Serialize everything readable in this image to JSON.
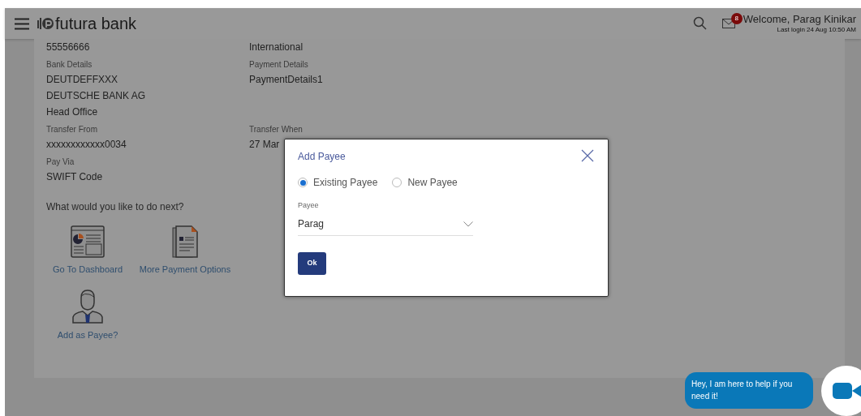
{
  "header": {
    "brand": "futura bank",
    "notifications": "8",
    "welcome": "Welcome, Parag Kinikar",
    "last_login": "Last login 24 Aug 10:50 AM"
  },
  "details": [
    {
      "left": {
        "values": [
          "55556666"
        ]
      },
      "right": {
        "values": [
          "International"
        ]
      }
    },
    {
      "left": {
        "label": "Bank Details",
        "values": [
          "DEUTDEFFXXX",
          "DEUTSCHE BANK AG",
          "Head Office"
        ]
      },
      "right": {
        "label": "Payment Details",
        "values": [
          "PaymentDetails1"
        ]
      }
    },
    {
      "left": {
        "label": "Transfer From",
        "values": [
          "xxxxxxxxxxxx0034"
        ]
      },
      "right": {
        "label": "Transfer When",
        "values": [
          "27 Mar"
        ]
      }
    },
    {
      "left": {
        "label": "Pay Via",
        "values": [
          "SWIFT Code"
        ]
      }
    }
  ],
  "next_prompt": "What would you like to do next?",
  "actions": [
    {
      "kind": "dashboard",
      "label": "Go To Dashboard"
    },
    {
      "kind": "payment",
      "label": "More Payment Options"
    },
    {
      "kind": "payee",
      "label": "Add as Payee?"
    }
  ],
  "dialog": {
    "title": "Add Payee",
    "options": [
      {
        "label": "Existing Payee",
        "selected": true
      },
      {
        "label": "New Payee",
        "selected": false
      }
    ],
    "field_label": "Payee",
    "field_value": "Parag",
    "button": "Ok"
  },
  "chat": {
    "message": "Hey, I am here to help if you need it!"
  }
}
